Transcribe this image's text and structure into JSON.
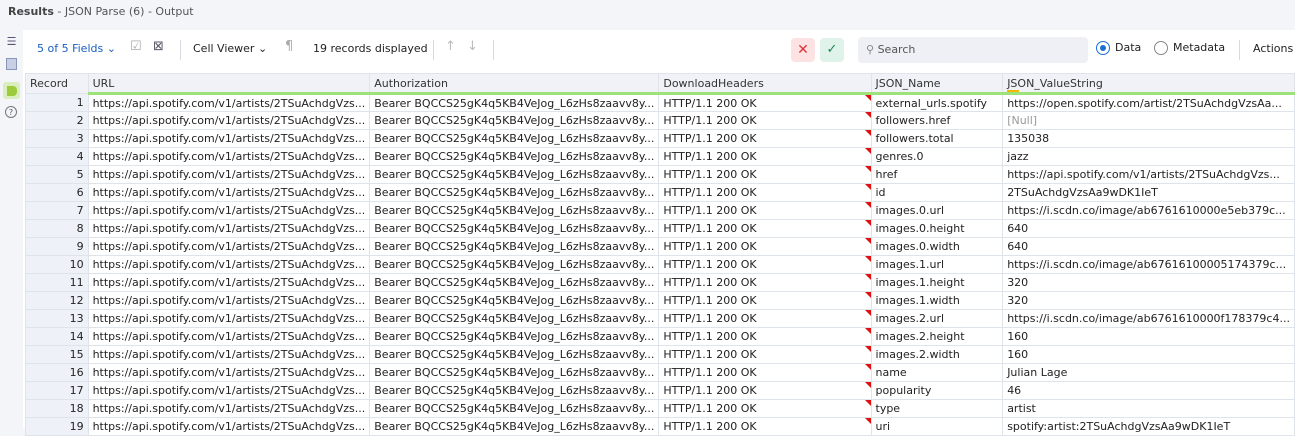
{
  "title": {
    "main": "Results",
    "sub": " - JSON Parse (6) - Output"
  },
  "toolbar": {
    "fields": "5 of 5 Fields",
    "cell_viewer": "Cell Viewer",
    "records": "19 records displayed",
    "search_placeholder": "Search",
    "data": "Data",
    "metadata": "Metadata",
    "actions": "Actions"
  },
  "columns": [
    "Record",
    "URL",
    "Authorization",
    "DownloadHeaders",
    "JSON_Name",
    "JSON_ValueString"
  ],
  "common": {
    "url": "https://api.spotify.com/v1/artists/2TSuAchdgVzs...",
    "auth": "Bearer  BQCCS25gK4q5KB4VeJog_L6zHs8zaavv8y...",
    "headers": "HTTP/1.1 200 OK"
  },
  "rows": [
    [
      "1",
      "external_urls.spotify",
      "https://open.spotify.com/artist/2TSuAchdgVzsAa..."
    ],
    [
      "2",
      "followers.href",
      "[Null]"
    ],
    [
      "3",
      "followers.total",
      "135038"
    ],
    [
      "4",
      "genres.0",
      "jazz"
    ],
    [
      "5",
      "href",
      "https://api.spotify.com/v1/artists/2TSuAchdgVzs..."
    ],
    [
      "6",
      "id",
      "2TSuAchdgVzsAa9wDK1IeT"
    ],
    [
      "7",
      "images.0.url",
      "https://i.scdn.co/image/ab6761610000e5eb379c..."
    ],
    [
      "8",
      "images.0.height",
      "640"
    ],
    [
      "9",
      "images.0.width",
      "640"
    ],
    [
      "10",
      "images.1.url",
      "https://i.scdn.co/image/ab67616100005174379c..."
    ],
    [
      "11",
      "images.1.height",
      "320"
    ],
    [
      "12",
      "images.1.width",
      "320"
    ],
    [
      "13",
      "images.2.url",
      "https://i.scdn.co/image/ab6761610000f178379c4..."
    ],
    [
      "14",
      "images.2.height",
      "160"
    ],
    [
      "15",
      "images.2.width",
      "160"
    ],
    [
      "16",
      "name",
      "Julian Lage"
    ],
    [
      "17",
      "popularity",
      "46"
    ],
    [
      "18",
      "type",
      "artist"
    ],
    [
      "19",
      "uri",
      "spotify:artist:2TSuAchdgVzsAa9wDK1IeT"
    ]
  ]
}
